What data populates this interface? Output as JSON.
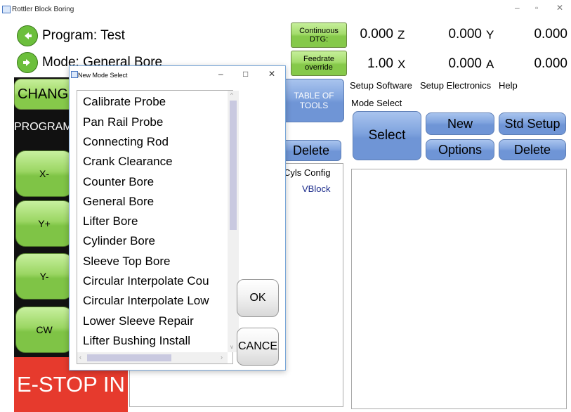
{
  "window": {
    "title": "Rottler Block Boring",
    "controls": [
      "–",
      "▫",
      "✕"
    ]
  },
  "program": {
    "label": "Program: Test",
    "mode_label": "Mode: General Bore"
  },
  "buttons": {
    "continuous_dtg": "Continuous DTG:",
    "feedrate_override": "Feedrate override",
    "change": "CHANGE",
    "program": "PROGRAM",
    "table_of_tools": "TABLE OF TOOLS",
    "delete_left": "Delete"
  },
  "readouts": [
    {
      "value": "0.000",
      "axis": "Z"
    },
    {
      "value": "0.000",
      "axis": "Y"
    },
    {
      "value": "0.000",
      "axis": ""
    },
    {
      "value": "1.00",
      "axis": "X"
    },
    {
      "value": "0.000",
      "axis": "A"
    },
    {
      "value": "0.000",
      "axis": ""
    }
  ],
  "menu": [
    "Setup Software",
    "Setup Electronics",
    "Help"
  ],
  "mode_select": {
    "label": "Mode Select",
    "select": "Select",
    "new": "New",
    "std_setup": "Std Setup",
    "options": "Options",
    "delete": "Delete"
  },
  "partial_panel": {
    "header": "Cyls Config",
    "item": "VBlock"
  },
  "jog": [
    "X-",
    "Y+",
    "Y-",
    "CW"
  ],
  "estop": "E-STOP IN",
  "dialog": {
    "title": "New Mode Select",
    "items": [
      "Calibrate Probe",
      "Pan Rail Probe",
      "Connecting Rod",
      "Crank Clearance",
      "Counter Bore",
      "General Bore",
      "Lifter Bore",
      "Cylinder Bore",
      "Sleeve Top Bore",
      "Circular Interpolate Cou",
      "Circular Interpolate Low",
      "Lower Sleeve Repair",
      "Lifter Bushing Install"
    ],
    "ok": "OK",
    "cancel": "CANCE"
  },
  "colors": {
    "green_button": "#86c94a",
    "blue_button": "#6f95d6",
    "estop": "#e63a2d",
    "dark_panel": "#111111"
  }
}
